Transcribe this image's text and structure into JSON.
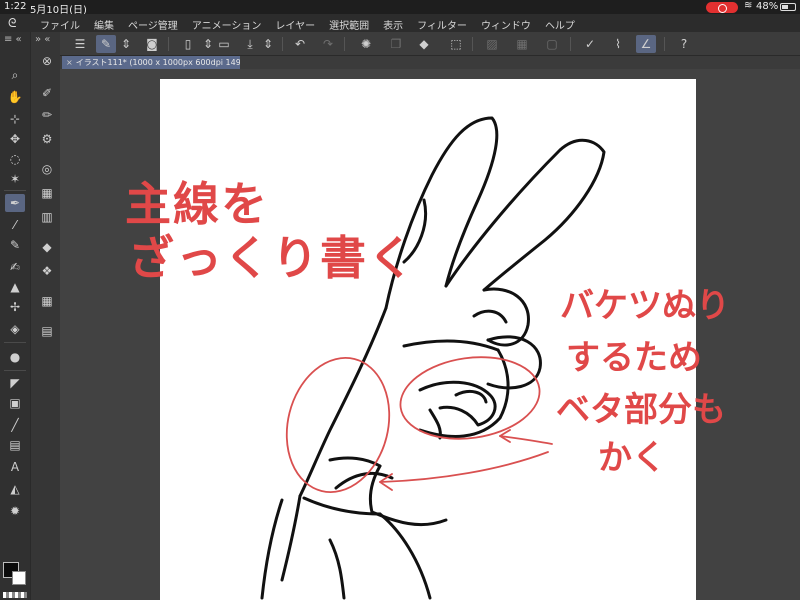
{
  "status_bar": {
    "time": "1:22",
    "date": "5月10日(日)",
    "battery": "48%",
    "record_color": "#e23030"
  },
  "menu": {
    "items": [
      "ファイル",
      "編集",
      "ページ管理",
      "アニメーション",
      "レイヤー",
      "選択範囲",
      "表示",
      "フィルター",
      "ウィンドウ",
      "ヘルプ"
    ]
  },
  "document": {
    "tab_label": "イラスト111* (1000 x 1000px 600dpi 149.3%)"
  },
  "colors": {
    "main": "#0a0a0a",
    "sub": "#ffffff",
    "accent": "#5a6682",
    "annotation": "#e04848"
  },
  "annotations": {
    "line1": "主線を",
    "line2": "ざっくり書く",
    "note1": "バケツぬり",
    "note2": "するため",
    "note3": "ベタ部分も",
    "note4": "かく"
  },
  "icons": {
    "left_tools": [
      "magnifier-icon",
      "hand-icon",
      "operation-icon",
      "move-icon",
      "lasso-icon",
      "magic-wand-icon",
      "pen-icon",
      "eyedropper-icon",
      "pencil-icon",
      "brush-icon",
      "airbrush-icon",
      "decoration-icon",
      "eraser-icon",
      "blend-icon",
      "fill-icon",
      "gradient-icon",
      "figure-icon",
      "ruler-icon",
      "text-icon",
      "balloon-icon",
      "correction-icon"
    ]
  }
}
